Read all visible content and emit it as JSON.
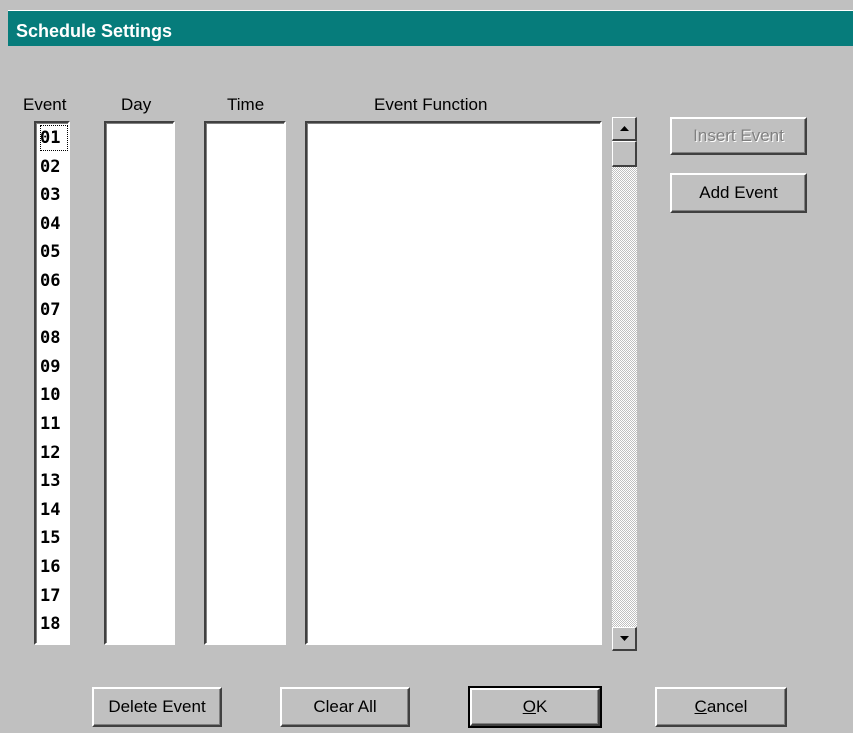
{
  "window": {
    "title": "Schedule Settings"
  },
  "columns": {
    "event": "Event",
    "day": "Day",
    "time": "Time",
    "event_function": "Event Function"
  },
  "events": [
    "01",
    "02",
    "03",
    "04",
    "05",
    "06",
    "07",
    "08",
    "09",
    "10",
    "11",
    "12",
    "13",
    "14",
    "15",
    "16",
    "17",
    "18"
  ],
  "side_buttons": {
    "insert_event": "Insert Event",
    "add_event": "Add Event"
  },
  "bottom_buttons": {
    "delete_event": "Delete Event",
    "clear_all": "Clear All",
    "ok_mnemonic": "O",
    "ok_rest": "K",
    "cancel_mnemonic": "C",
    "cancel_rest": "ancel"
  },
  "colors": {
    "titlebar": "#067c7b",
    "face": "#c0c0c0"
  }
}
